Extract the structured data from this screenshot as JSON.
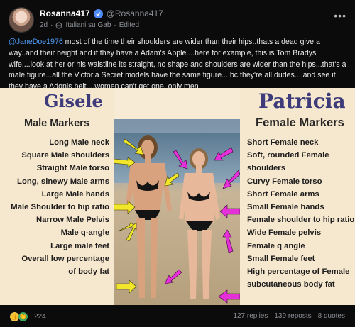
{
  "post": {
    "author": {
      "display_name": "Rosanna417",
      "handle": "@Rosanna417",
      "verified": true
    },
    "meta": {
      "age": "2d",
      "sep1": "·",
      "group": "Italiani su Gab",
      "sep2": "·",
      "edited": "Edited",
      "globe_icon": "globe-icon"
    },
    "text": {
      "mention": "@JaneDoe1976",
      "body": " most of the time their shoulders are wider than their hips..thats a dead give a way..and their height and if they have a Adam's Apple....here for example, this is Tom Bradys wife....look at her or his waistline its straight, no shape and shoulders are wider than the hips...that's a male figure...all the Victoria Secret models have the same figure....bc they're all dudes....and see if they have a Adonis belt....women can't get one, only men"
    },
    "image": {
      "left": {
        "title": "Gisele",
        "subtitle": "Male Markers",
        "markers": [
          "Long Male neck",
          "Square Male shoulders",
          "Straight Male torso",
          "Long, sinewy Male arms",
          "Large Male hands",
          "Male Shoulder to hip ratio",
          "Narrow Male Pelvis",
          "Male q-angle",
          "Large male feet",
          "Overall low percentage",
          "of body fat"
        ],
        "arrow_color": "#f2e62a"
      },
      "right": {
        "title": "Patricia",
        "subtitle": "Female Markers",
        "markers": [
          "Short Female neck",
          "Soft, rounded Female",
          "shoulders",
          "Curvy Female torso",
          "Short Female arms",
          "Small Female hands",
          "Female shoulder to hip ratio",
          "Wide Female pelvis",
          "Female q angle",
          "Small Female feet",
          "High percentage of Female",
          "subcutaneous body fat"
        ],
        "arrow_color": "#e52fd9"
      }
    },
    "footer": {
      "reaction_icons": [
        "thumbs-up-icon",
        "clap-icon"
      ],
      "reaction_count": "224",
      "replies": "127 replies",
      "reposts": "139 reposts",
      "quotes": "8 quotes"
    },
    "colors": {
      "background": "#0b0b0b",
      "mention": "#4f9cf7",
      "verified": "#4f8cf7",
      "title": "#3d3b7a"
    }
  }
}
